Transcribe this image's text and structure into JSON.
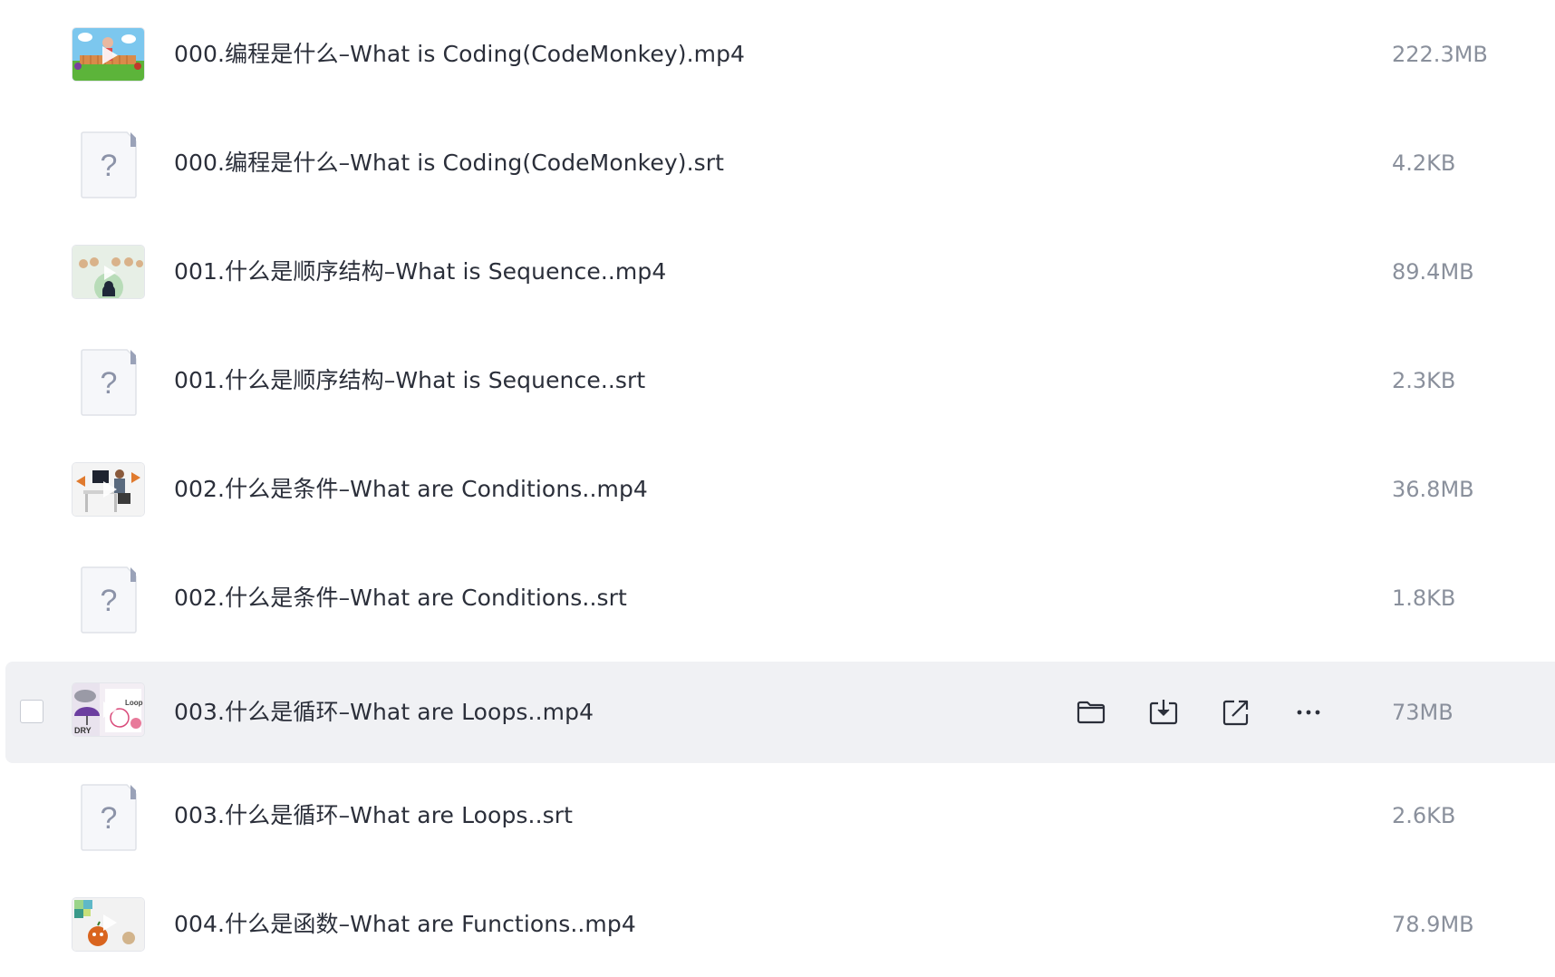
{
  "files": [
    {
      "name": "000.编程是什么–What is Coding(CodeMonkey).mp4",
      "size": "222.3MB",
      "type": "video",
      "thumb": "coding"
    },
    {
      "name": "000.编程是什么–What is Coding(CodeMonkey).srt",
      "size": "4.2KB",
      "type": "unknown"
    },
    {
      "name": "001.什么是顺序结构–What is Sequence..mp4",
      "size": "89.4MB",
      "type": "video",
      "thumb": "sequence"
    },
    {
      "name": "001.什么是顺序结构–What is Sequence..srt",
      "size": "2.3KB",
      "type": "unknown"
    },
    {
      "name": "002.什么是条件–What are Conditions..mp4",
      "size": "36.8MB",
      "type": "video",
      "thumb": "conditions"
    },
    {
      "name": "002.什么是条件–What are Conditions..srt",
      "size": "1.8KB",
      "type": "unknown"
    },
    {
      "name": "003.什么是循环–What are Loops..mp4",
      "size": "73MB",
      "type": "video",
      "thumb": "loops",
      "hovered": true
    },
    {
      "name": "003.什么是循环–What are Loops..srt",
      "size": "2.6KB",
      "type": "unknown"
    },
    {
      "name": "004.什么是函数–What are Functions..mp4",
      "size": "78.9MB",
      "type": "video",
      "thumb": "functions"
    }
  ],
  "row_actions": {
    "open_folder": "folder-icon",
    "download": "download-icon",
    "share": "share-icon",
    "more": "more-icon"
  },
  "thumb_texts": {
    "loops_label": "Loop",
    "loops_word": "DRY"
  },
  "colors": {
    "hover_bg": "#f0f1f4",
    "icon": "#2b2f3a",
    "size_text": "#8a909c",
    "unknown_mark": "#8c93a8"
  }
}
